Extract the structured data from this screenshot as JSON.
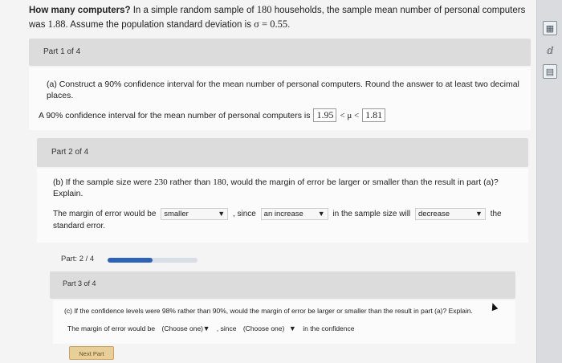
{
  "problem": {
    "title": "How many computers?",
    "text_1": "In a simple random sample of",
    "n": "180",
    "text_2": "households, the sample mean number of personal computers was",
    "mean": "1.88",
    "text_3": ". Assume the population standard deviation is",
    "sigma": "σ = 0.55",
    "text_4": "."
  },
  "part1": {
    "header": "Part 1 of 4",
    "question": "(a) Construct a 90% confidence interval for the mean number of personal computers. Round the answer to at least two decimal places.",
    "answer_prefix": "A 90% confidence interval for the mean number of personal computers is",
    "lower": "1.95",
    "mu": "< μ <",
    "upper": "1.81"
  },
  "part2": {
    "header": "Part 2 of 4",
    "question_1": "(b) If the sample size were",
    "n_new": "230",
    "question_2": "rather than",
    "n_old": "180",
    "question_3": ", would the margin of error be larger or smaller than the result in part (a)? Explain.",
    "ans_1": "The margin of error would be",
    "sel_1": "smaller",
    "ans_2": ", since",
    "sel_2": "an increase",
    "ans_3": "in the sample size will",
    "sel_3": "decrease",
    "ans_4": "the",
    "ans_5": "standard error."
  },
  "progress": {
    "label": "Part: 2 / 4",
    "fraction": 0.5
  },
  "part3": {
    "header": "Part 3 of 4",
    "question": "(c) If the confidence levels were 98% rather than 90%, would the margin of error be larger or smaller than the result in part (a)? Explain.",
    "ans_1": "The margin of error would be",
    "sel_1": "(Choose one)",
    "ans_2": ", since",
    "sel_2": "(Choose one)",
    "ans_3": "in the confidence"
  },
  "next_button": "Next Part",
  "sidebar_icons": [
    "calculator-icon",
    "data-table-icon",
    "book-icon"
  ]
}
